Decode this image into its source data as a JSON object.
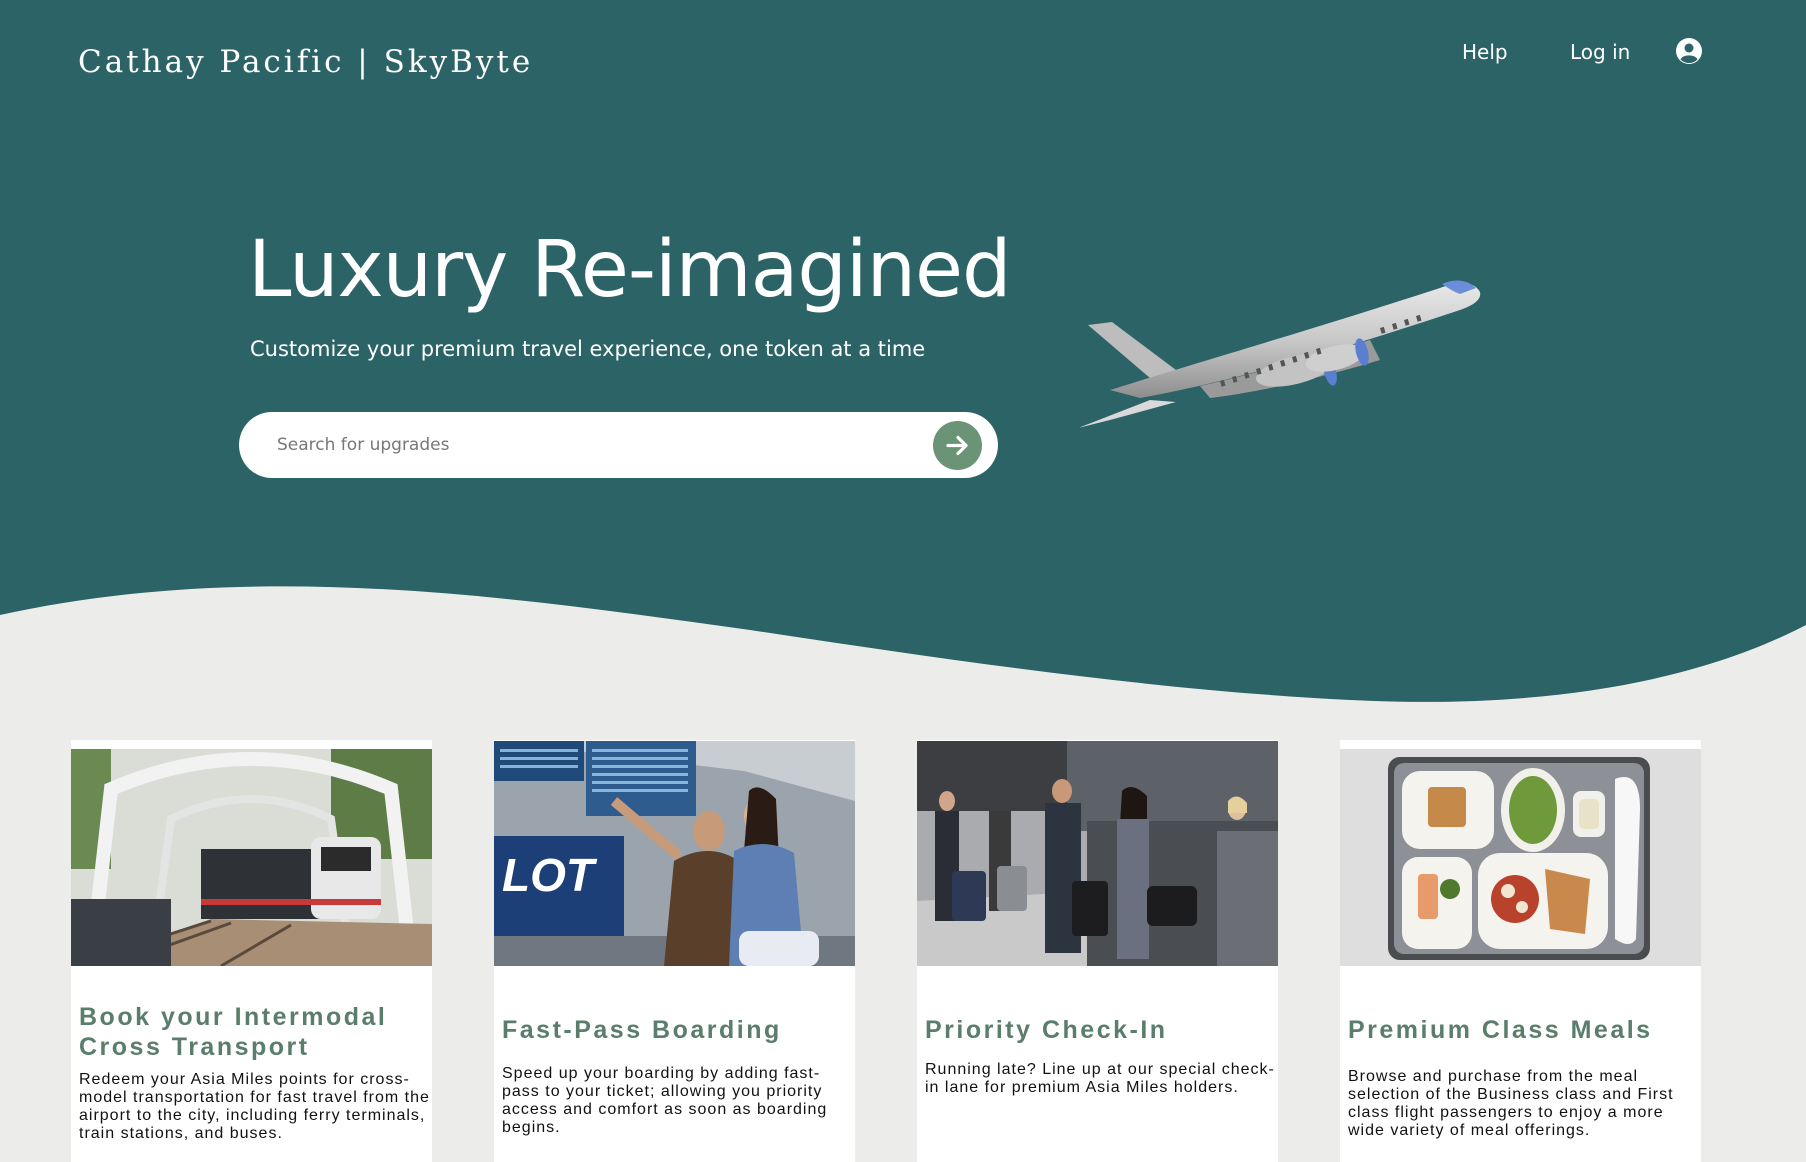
{
  "header": {
    "logo_text": "Cathay Pacific | SkyByte",
    "nav": {
      "help_label": "Help",
      "login_label": "Log in"
    },
    "account_icon": "user-circle-icon"
  },
  "hero": {
    "title": "Luxury Re-imagined",
    "subtitle": "Customize your premium travel experience, one token at a time",
    "search": {
      "placeholder": "Search for upgrades",
      "value": "",
      "submit_icon": "arrow-right-icon"
    },
    "illustration": "airplane"
  },
  "cards": [
    {
      "title": "Book your Intermodal Cross Transport",
      "description": "Redeem your Asia Miles points for cross-model transportation for fast travel from the airport to the city, including ferry terminals, train stations, and buses.",
      "image": "train-photo"
    },
    {
      "title": "Fast-Pass Boarding",
      "description": "Speed up your boarding by adding fast-pass to your ticket; allowing you priority access and comfort as soon as boarding begins.",
      "image": "airport-couple-photo",
      "image_text": "LOT"
    },
    {
      "title": "Priority Check-In",
      "description": "Running late? Line up at our special check-in lane for premium Asia Miles holders.",
      "image": "check-in-counter-photo"
    },
    {
      "title": "Premium Class Meals",
      "description": "Browse and purchase from the meal selection of the Business class and First class flight passengers to enjoy a more wide variety of meal offerings.",
      "image": "meal-tray-photo"
    }
  ],
  "colors": {
    "hero_bg": "#2b6366",
    "page_bg": "#ecedeb",
    "accent": "#6b9376",
    "card_title": "#5a7d6c"
  }
}
